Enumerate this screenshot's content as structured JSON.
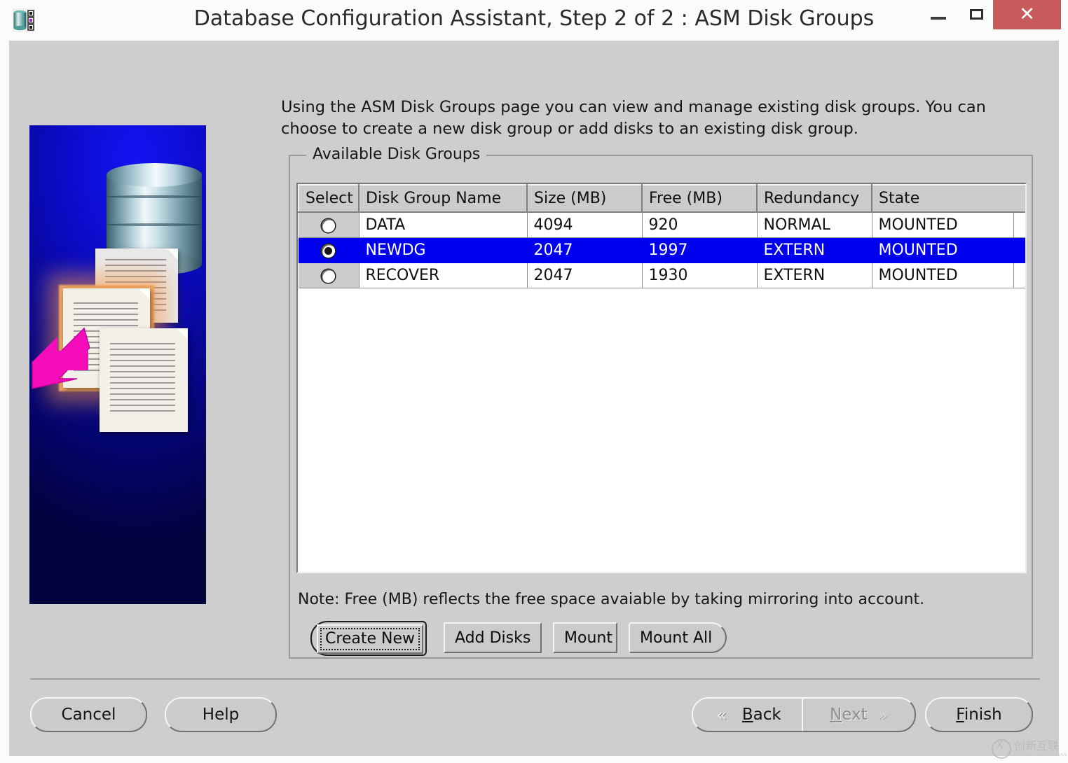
{
  "window": {
    "title": "Database Configuration Assistant, Step 2 of 2 : ASM Disk Groups",
    "app_icon": "database-icon",
    "controls": {
      "minimize": "–",
      "maximize": "□",
      "close": "✕",
      "close_color": "#c75b5b"
    }
  },
  "instructions": "Using the ASM Disk Groups page you can view and manage existing disk groups. You can choose to create a new disk group or add disks to an existing disk group.",
  "groupbox": {
    "title": "Available Disk Groups"
  },
  "table": {
    "columns": [
      "Select",
      "Disk Group Name",
      "Size (MB)",
      "Free (MB)",
      "Redundancy",
      "State"
    ],
    "rows": [
      {
        "selected": false,
        "name": "DATA",
        "size_mb": "4094",
        "free_mb": "920",
        "redundancy": "NORMAL",
        "state": "MOUNTED"
      },
      {
        "selected": true,
        "name": "NEWDG",
        "size_mb": "2047",
        "free_mb": "1997",
        "redundancy": "EXTERN",
        "state": "MOUNTED"
      },
      {
        "selected": false,
        "name": "RECOVER",
        "size_mb": "2047",
        "free_mb": "1930",
        "redundancy": "EXTERN",
        "state": "MOUNTED"
      }
    ],
    "selection_color": "#0000ee",
    "header_bg": "#cbcbcb"
  },
  "note": "Note: Free (MB) reflects the free space avaiable by taking mirroring into account.",
  "actions": {
    "create_new": "Create New",
    "add_disks": "Add Disks",
    "mount": "Mount",
    "mount_all": "Mount All"
  },
  "navigation": {
    "cancel": "Cancel",
    "help": "Help",
    "back": "Back",
    "back_mnemonic": "B",
    "back_rest": "ack",
    "next": "Next",
    "next_mnemonic": "N",
    "next_rest": "ext",
    "next_disabled": true,
    "finish": "Finish",
    "finish_mnemonic": "F",
    "finish_rest": "inish",
    "back_chevron": "«",
    "next_chevron": "»"
  },
  "watermark": {
    "text": "创新互联",
    "subtext": "CHUANG XIN HU LIAN",
    "logo": "circle-x-logo"
  },
  "sidebar_art": {
    "alt": "database-and-documents-illustration",
    "background_color": "#0b0bc4",
    "arrow_color": "#f50dbb"
  }
}
